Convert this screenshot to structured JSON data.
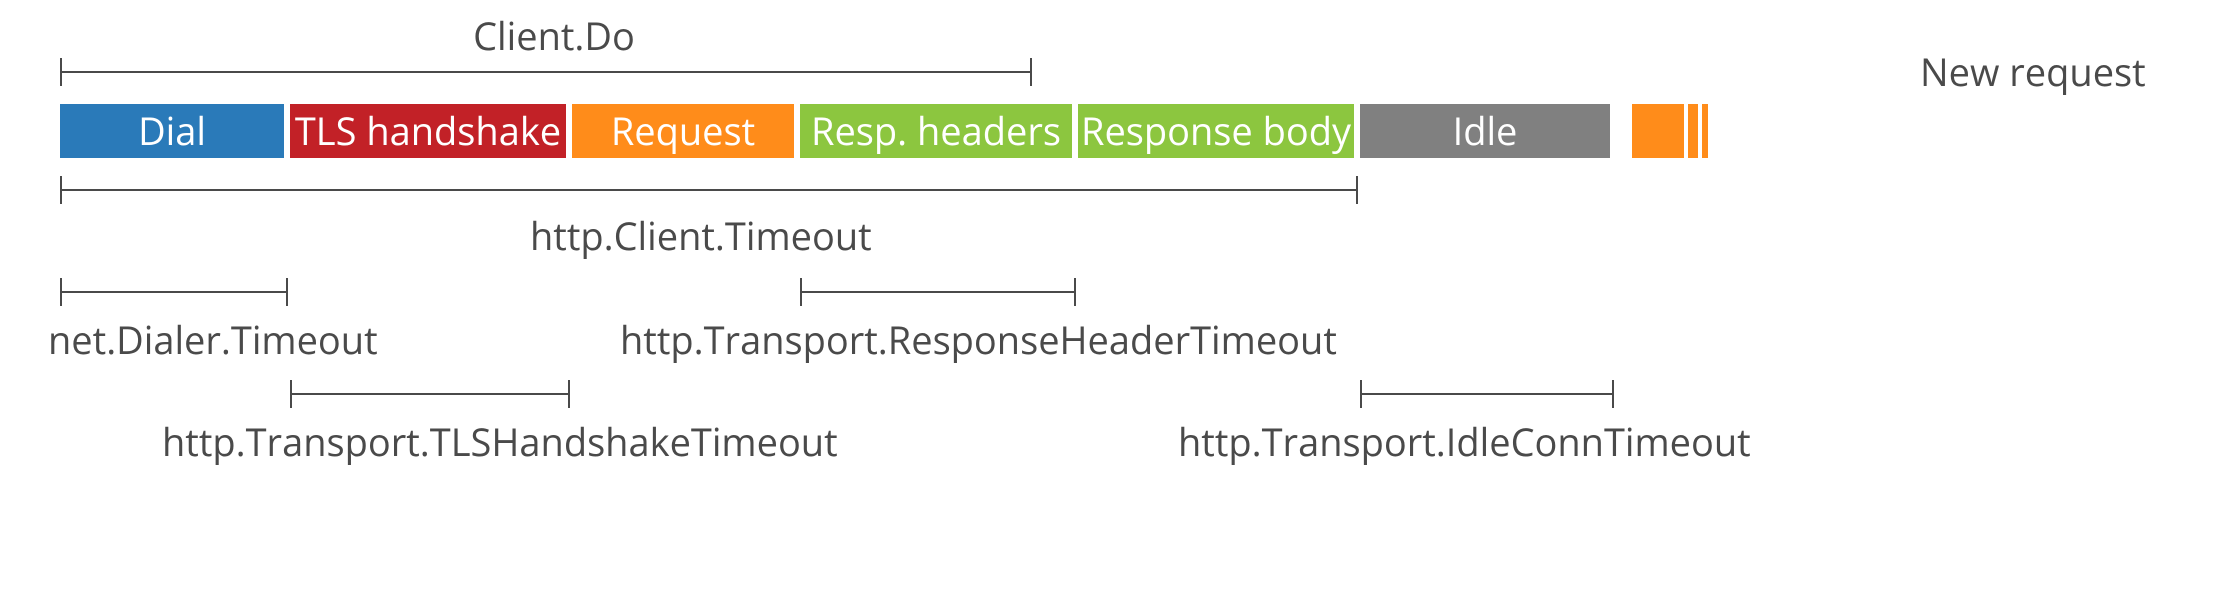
{
  "labels": {
    "client_do": "Client.Do",
    "new_request": "New request",
    "http_client_timeout": "http.Client.Timeout",
    "net_dialer_timeout": "net.Dialer.Timeout",
    "resp_header_timeout": "http.Transport.ResponseHeaderTimeout",
    "tls_handshake_timeout": "http.Transport.TLSHandshakeTimeout",
    "idle_conn_timeout": "http.Transport.IdleConnTimeout"
  },
  "phases": {
    "dial": "Dial",
    "tls": "TLS handshake",
    "request": "Request",
    "resp_headers": "Resp. headers",
    "resp_body": "Response body",
    "idle": "Idle"
  },
  "colors": {
    "blue": "#2a7ab9",
    "red": "#c22127",
    "orange": "#ff8c1a",
    "green": "#8cc63f",
    "gray": "#808080",
    "text": "#4a4a4a"
  }
}
